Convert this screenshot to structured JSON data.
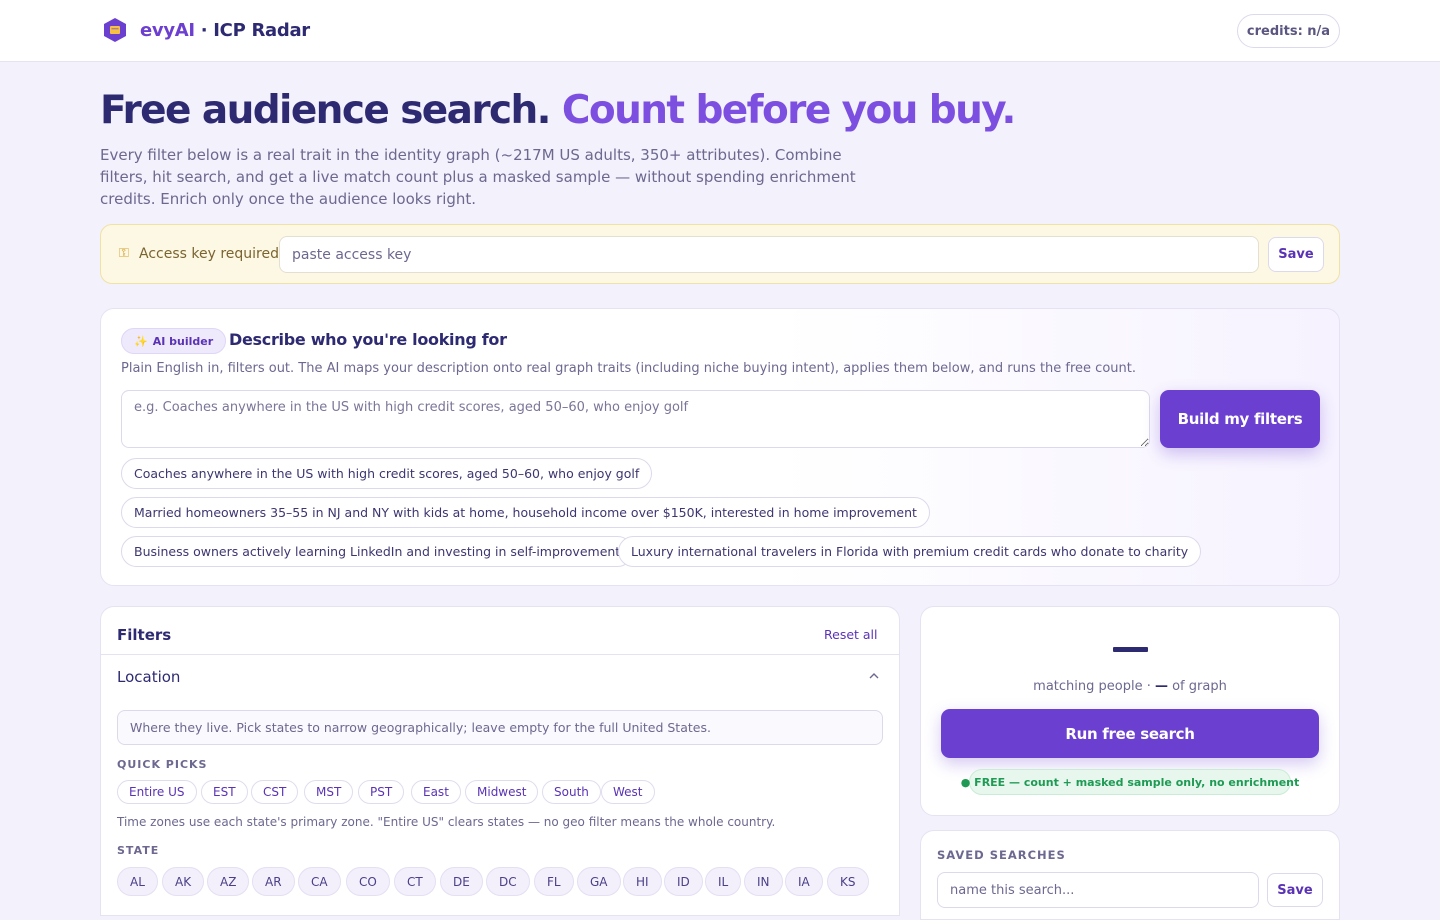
{
  "header": {
    "brand_name": "evyAI",
    "brand_suffix": " · ICP Radar",
    "credits": "credits: n/a"
  },
  "hero": {
    "title_main": "Free audience search. ",
    "title_accent": "Count before you buy.",
    "description": "Every filter below is a real trait in the identity graph (~217M US adults, 350+ attributes). Combine filters, hit search, and get a live match count plus a masked sample — without spending enrichment credits. Enrich only once the audience looks right."
  },
  "access_key": {
    "icon": "key-icon",
    "label": "Access key required:",
    "placeholder": "paste access key",
    "value": "",
    "save_label": "Save"
  },
  "ai_builder": {
    "badge_icon": "sparkles-icon",
    "badge": "AI builder",
    "title": "Describe who you're looking for",
    "description": "Plain English in, filters out. The AI maps your description onto real graph traits (including niche buying intent), applies them below, and runs the free count.",
    "placeholder": "e.g. Coaches anywhere in the US with high credit scores, aged 50–60, who enjoy golf",
    "value": "",
    "build_label": "Build my filters",
    "examples": [
      "Coaches anywhere in the US with high credit scores, aged 50–60, who enjoy golf",
      "Married homeowners 35–55 in NJ and NY with kids at home, household income over $150K, interested in home improvement",
      "Business owners actively learning LinkedIn and investing in self-improvement",
      "Luxury international travelers in Florida with premium credit cards who donate to charity"
    ]
  },
  "filters": {
    "title": "Filters",
    "reset_label": "Reset all",
    "location": {
      "title": "Location",
      "chevron_icon": "chevron-up-icon",
      "hint": "Where they live. Pick states to narrow geographically; leave empty for the full United States.",
      "quick_picks_label": "QUICK PICKS",
      "quick_picks": [
        "Entire US",
        "EST",
        "CST",
        "MST",
        "PST",
        "East",
        "Midwest",
        "South",
        "West"
      ],
      "tz_note": "Time zones use each state's primary zone. \"Entire US\" clears states — no geo filter means the whole country.",
      "state_label": "STATE",
      "states": [
        "AL",
        "AK",
        "AZ",
        "AR",
        "CA",
        "CO",
        "CT",
        "DE",
        "DC",
        "FL",
        "GA",
        "HI",
        "ID",
        "IL",
        "IN",
        "IA",
        "KS"
      ]
    }
  },
  "results": {
    "count": "",
    "sub_label": "matching people · ",
    "sub_dash": "—",
    "sub_suffix": " of graph",
    "run_label": "Run free search",
    "free_note": "● FREE — count + masked sample only, no enrichment"
  },
  "saved_searches": {
    "title": "SAVED SEARCHES",
    "placeholder": "name this search...",
    "value": "",
    "save_label": "Save"
  },
  "colors": {
    "brand_dark": "#2d2a72",
    "accent": "#6b3fcf",
    "accent_light": "#7c4fe0",
    "free_green": "#1f9a55",
    "key_banner": "#fdf8e4"
  }
}
